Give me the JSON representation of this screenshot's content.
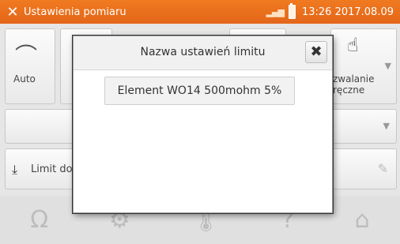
{
  "topbar": {
    "title": "Ustawienia pomiaru",
    "clock": "13:26 2017.08.09",
    "tools_icon": "tools-icon",
    "signal_icon": "signal-icon",
    "battery_icon": "battery-icon"
  },
  "tiles": {
    "auto_label": "Auto",
    "trigger_label_line1": "zwalanie",
    "trigger_label_line2": "ręczne",
    "limit_label": "Limit do"
  },
  "dialog": {
    "title": "Nazwa ustawień limitu",
    "value": "Element WO14 500mohm 5%",
    "close_icon": "close-icon"
  },
  "bottom_icons": [
    "ohm-icon",
    "gear-icon",
    "thermometer-icon",
    "help-icon",
    "home-icon"
  ],
  "colors": {
    "accent": "#e8701d",
    "background": "#e6e6e6"
  }
}
